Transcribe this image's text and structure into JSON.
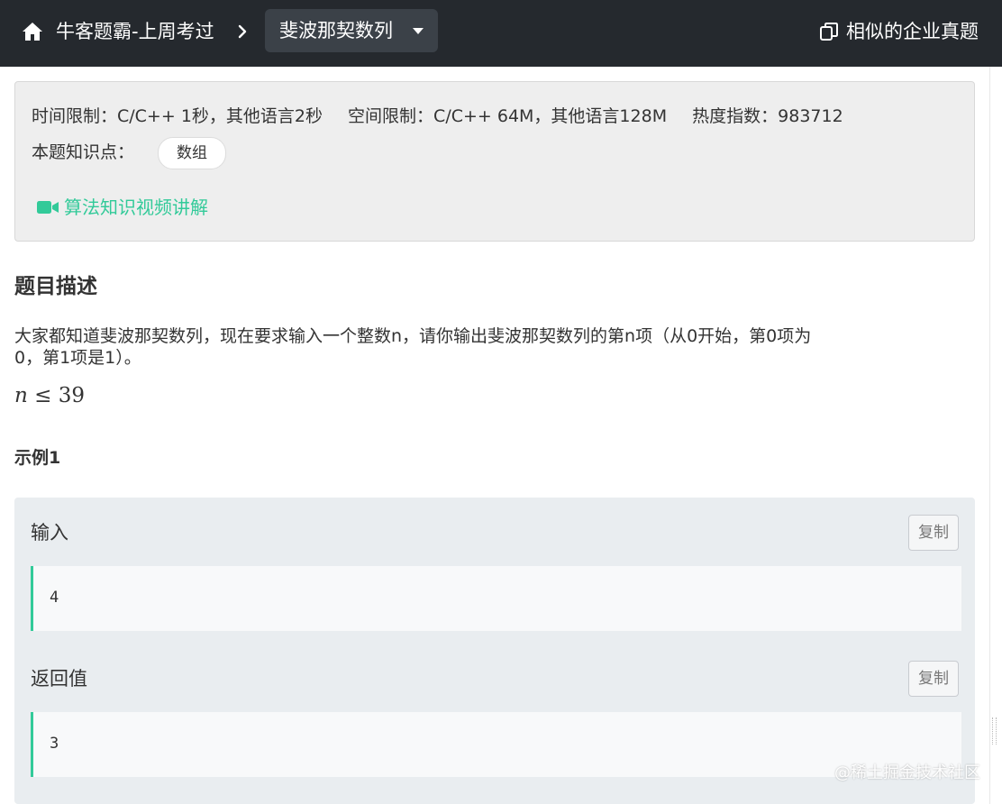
{
  "nav": {
    "breadcrumb": "牛客题霸-上周考过",
    "current_problem": "斐波那契数列",
    "similar_link": "相似的企业真题"
  },
  "info": {
    "time_limit": "时间限制：C/C++ 1秒，其他语言2秒",
    "space_limit": "空间限制：C/C++ 64M，其他语言128M",
    "heat": "热度指数：983712",
    "knowledge_label": "本题知识点：",
    "knowledge_tag": "数组",
    "video_link": "算法知识视频讲解"
  },
  "description": {
    "title": "题目描述",
    "text_line1": "大家都知道斐波那契数列，现在要求输入一个整数n，请你输出斐波那契数列的第n项（从0开始，第0项为",
    "text_line2": "0，第1项是1）。",
    "formula_var": "n",
    "formula_rest": " ≤ 39"
  },
  "example": {
    "title": "示例1",
    "input_label": "输入",
    "input_value": "4",
    "output_label": "返回值",
    "output_value": "3",
    "copy_label": "复制"
  },
  "watermark": "@稀土掘金技术社区",
  "colors": {
    "topbar": "#25292e",
    "accent": "#32ca99"
  }
}
